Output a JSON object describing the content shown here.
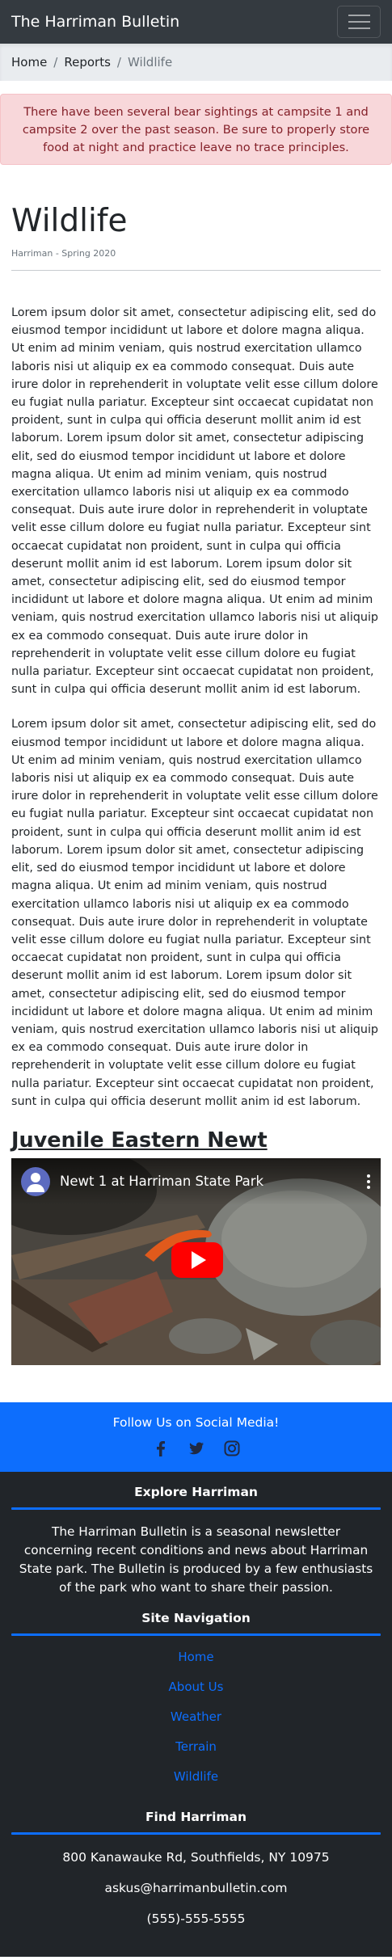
{
  "navbar": {
    "brand": "The Harriman Bulletin"
  },
  "breadcrumb": {
    "items": [
      "Home",
      "Reports",
      "Wildlife"
    ]
  },
  "alert": {
    "text": "There have been several bear sightings at campsite 1 and campsite 2 over the past season. Be sure to properly store food at night and practice leave no trace principles."
  },
  "article": {
    "title": "Wildlife",
    "byline": "Harriman - Spring 2020",
    "paragraphs": [
      "Lorem ipsum dolor sit amet, consectetur adipiscing elit, sed do eiusmod tempor incididunt ut labore et dolore magna aliqua. Ut enim ad minim veniam, quis nostrud exercitation ullamco laboris nisi ut aliquip ex ea commodo consequat. Duis aute irure dolor in reprehenderit in voluptate velit esse cillum dolore eu fugiat nulla pariatur. Excepteur sint occaecat cupidatat non proident, sunt in culpa qui officia deserunt mollit anim id est laborum. Lorem ipsum dolor sit amet, consectetur adipiscing elit, sed do eiusmod tempor incididunt ut labore et dolore magna aliqua. Ut enim ad minim veniam, quis nostrud exercitation ullamco laboris nisi ut aliquip ex ea commodo consequat. Duis aute irure dolor in reprehenderit in voluptate velit esse cillum dolore eu fugiat nulla pariatur. Excepteur sint occaecat cupidatat non proident, sunt in culpa qui officia deserunt mollit anim id est laborum. Lorem ipsum dolor sit amet, consectetur adipiscing elit, sed do eiusmod tempor incididunt ut labore et dolore magna aliqua. Ut enim ad minim veniam, quis nostrud exercitation ullamco laboris nisi ut aliquip ex ea commodo consequat. Duis aute irure dolor in reprehenderit in voluptate velit esse cillum dolore eu fugiat nulla pariatur. Excepteur sint occaecat cupidatat non proident, sunt in culpa qui officia deserunt mollit anim id est laborum.",
      "Lorem ipsum dolor sit amet, consectetur adipiscing elit, sed do eiusmod tempor incididunt ut labore et dolore magna aliqua. Ut enim ad minim veniam, quis nostrud exercitation ullamco laboris nisi ut aliquip ex ea commodo consequat. Duis aute irure dolor in reprehenderit in voluptate velit esse cillum dolore eu fugiat nulla pariatur. Excepteur sint occaecat cupidatat non proident, sunt in culpa qui officia deserunt mollit anim id est laborum. Lorem ipsum dolor sit amet, consectetur adipiscing elit, sed do eiusmod tempor incididunt ut labore et dolore magna aliqua. Ut enim ad minim veniam, quis nostrud exercitation ullamco laboris nisi ut aliquip ex ea commodo consequat. Duis aute irure dolor in reprehenderit in voluptate velit esse cillum dolore eu fugiat nulla pariatur. Excepteur sint occaecat cupidatat non proident, sunt in culpa qui officia deserunt mollit anim id est laborum. Lorem ipsum dolor sit amet, consectetur adipiscing elit, sed do eiusmod tempor incididunt ut labore et dolore magna aliqua. Ut enim ad minim veniam, quis nostrud exercitation ullamco laboris nisi ut aliquip ex ea commodo consequat. Duis aute irure dolor in reprehenderit in voluptate velit esse cillum dolore eu fugiat nulla pariatur. Excepteur sint occaecat cupidatat non proident, sunt in culpa qui officia deserunt mollit anim id est laborum."
    ]
  },
  "video_section": {
    "heading": "Juvenile Eastern Newt",
    "video_title": "Newt 1 at Harriman State Park"
  },
  "social": {
    "title": "Follow Us on Social Media!",
    "icons": [
      "facebook-icon",
      "twitter-icon",
      "instagram-icon"
    ]
  },
  "footer": {
    "explore_heading": "Explore Harriman",
    "explore_text": "The Harriman Bulletin is a seasonal newsletter concerning recent conditions and news about Harriman State park. The Bulletin is produced by a few enthusiasts of the park who want to share their passion.",
    "nav_heading": "Site Navigation",
    "nav_links": [
      "Home",
      "About Us",
      "Weather",
      "Terrain",
      "Wildlife"
    ],
    "find_heading": "Find Harriman",
    "address": "800 Kanawauke Rd, Southfields, NY 10975",
    "email": "askus@harrimanbulletin.com",
    "phone": "(555)-555-5555"
  },
  "colors": {
    "navbar": "#343a40",
    "primary": "#0d6efd",
    "alert_bg": "#f8d7da",
    "alert_text": "#842029",
    "footer": "#212529"
  }
}
